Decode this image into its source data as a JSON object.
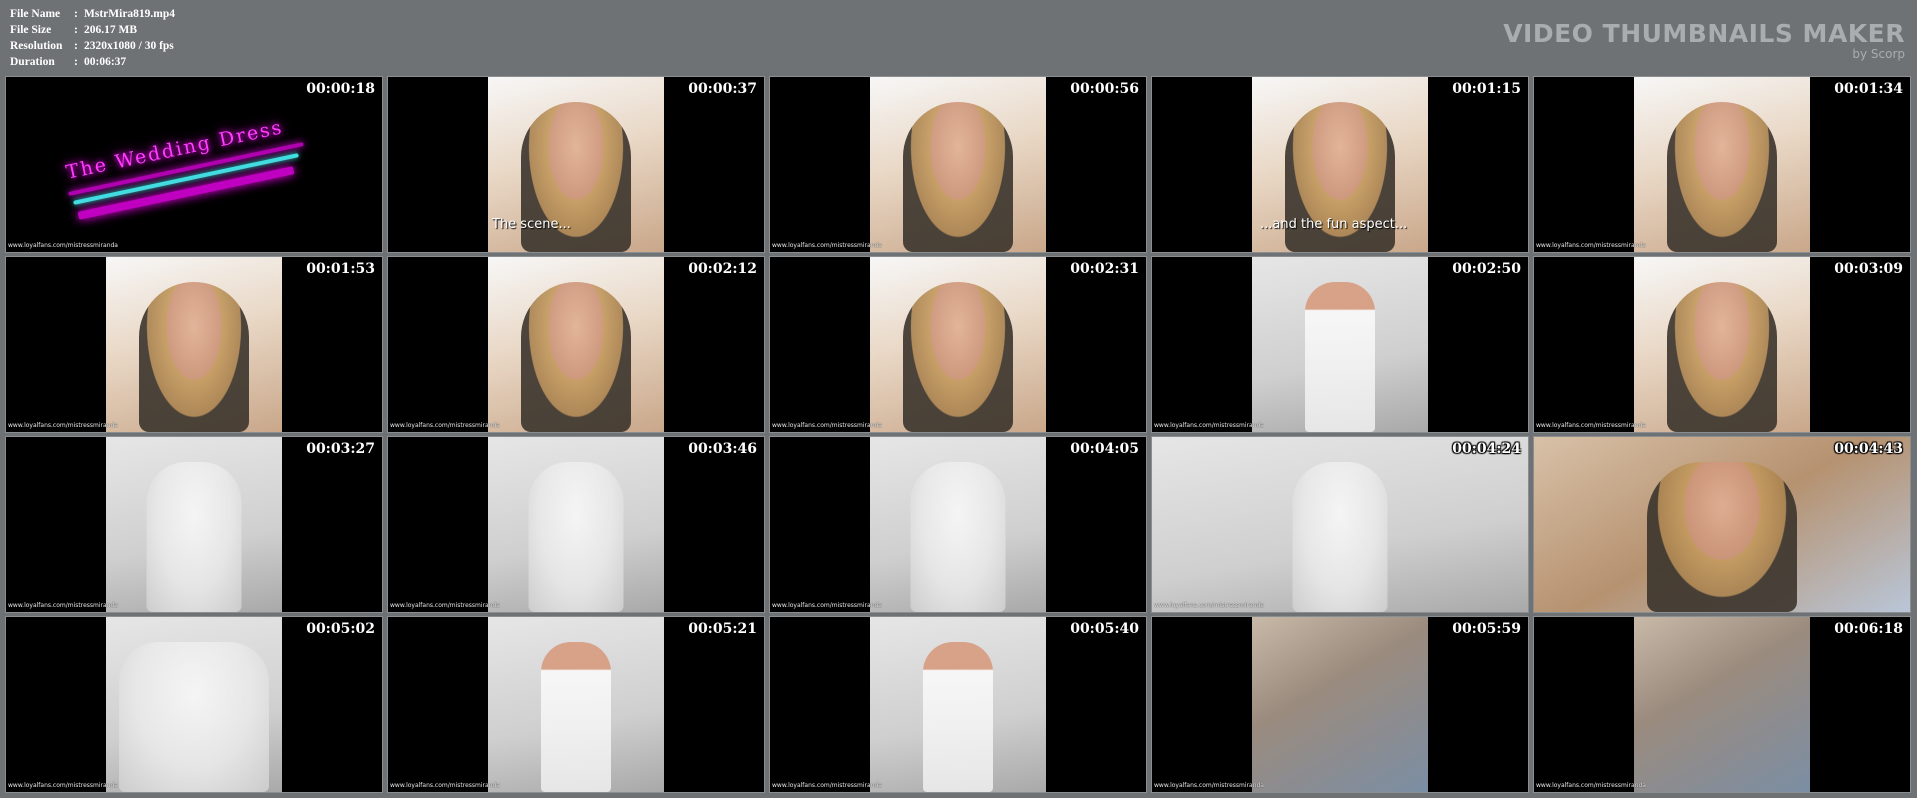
{
  "header": {
    "file_name_label": "File Name",
    "file_name_value": "MstrMira819.mp4",
    "file_size_label": "File Size",
    "file_size_value": "206.17 MB",
    "resolution_label": "Resolution",
    "resolution_value": "2320x1080 / 30 fps",
    "duration_label": "Duration",
    "duration_value": "00:06:37",
    "separator": ":"
  },
  "brand": {
    "title": "VIDEO THUMBNAILS MAKER",
    "subtitle": "by Scorp"
  },
  "watermark": "www.loyalfans.com/mistressmiranda",
  "title_card": {
    "text": "The Wedding Dress"
  },
  "thumbnails": [
    {
      "time": "00:00:18",
      "caption": ""
    },
    {
      "time": "00:00:37",
      "caption": "The scene..."
    },
    {
      "time": "00:00:56",
      "caption": ""
    },
    {
      "time": "00:01:15",
      "caption": "...and the fun aspect..."
    },
    {
      "time": "00:01:34",
      "caption": ""
    },
    {
      "time": "00:01:53",
      "caption": ""
    },
    {
      "time": "00:02:12",
      "caption": ""
    },
    {
      "time": "00:02:31",
      "caption": ""
    },
    {
      "time": "00:02:50",
      "caption": ""
    },
    {
      "time": "00:03:09",
      "caption": ""
    },
    {
      "time": "00:03:27",
      "caption": ""
    },
    {
      "time": "00:03:46",
      "caption": ""
    },
    {
      "time": "00:04:05",
      "caption": ""
    },
    {
      "time": "00:04:24",
      "caption": ""
    },
    {
      "time": "00:04:43",
      "caption": ""
    },
    {
      "time": "00:05:02",
      "caption": ""
    },
    {
      "time": "00:05:21",
      "caption": ""
    },
    {
      "time": "00:05:40",
      "caption": ""
    },
    {
      "time": "00:05:59",
      "caption": ""
    },
    {
      "time": "00:06:18",
      "caption": ""
    }
  ],
  "colors": {
    "background": "#6e7274",
    "brand_text": "#a9adaf",
    "title_neon": "#ff3dff",
    "streak_cyan": "#3fe0e0"
  }
}
